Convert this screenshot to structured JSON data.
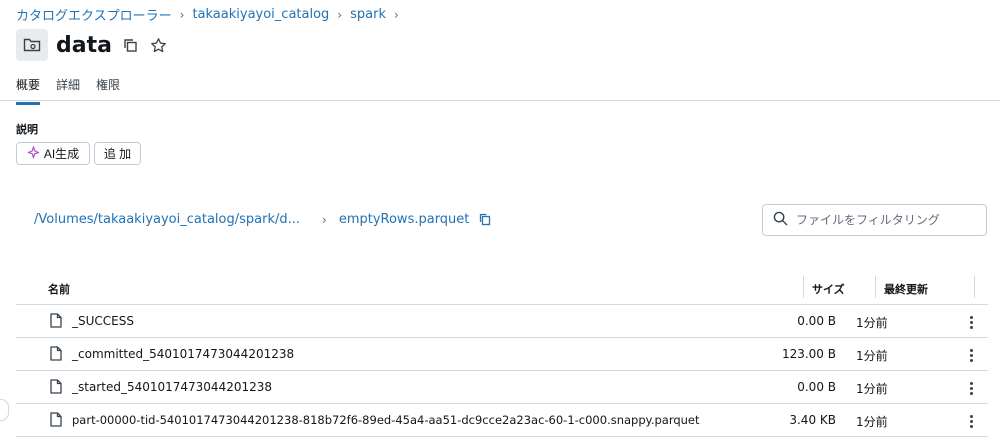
{
  "breadcrumb": {
    "items": [
      "カタログエクスプローラー",
      "takaakiyayoi_catalog",
      "spark"
    ],
    "separator": "›"
  },
  "page": {
    "title": "data"
  },
  "tabs": [
    "概要",
    "詳細",
    "権限"
  ],
  "description": {
    "label": "説明",
    "ai_button": "AI生成",
    "add_button": "追 加"
  },
  "path": {
    "volume": "/Volumes/takaakiyayoi_catalog/spark/d...",
    "leaf": "emptyRows.parquet"
  },
  "search": {
    "placeholder": "ファイルをフィルタリング"
  },
  "table": {
    "headers": {
      "name": "名前",
      "size": "サイズ",
      "modified": "最終更新"
    },
    "rows": [
      {
        "name": "_SUCCESS",
        "size": "0.00 B",
        "modified": "1分前"
      },
      {
        "name": "_committed_5401017473044201238",
        "size": "123.00 B",
        "modified": "1分前"
      },
      {
        "name": "_started_5401017473044201238",
        "size": "0.00 B",
        "modified": "1分前"
      },
      {
        "name": "part-00000-tid-5401017473044201238-818b72f6-89ed-45a4-aa51-dc9cce2a23ac-60-1-c000.snappy.parquet",
        "size": "3.40 KB",
        "modified": "1分前"
      }
    ]
  },
  "colors": {
    "link": "#2272b4",
    "border": "#d1d9e1",
    "ai_accent": "#b04fc7"
  }
}
